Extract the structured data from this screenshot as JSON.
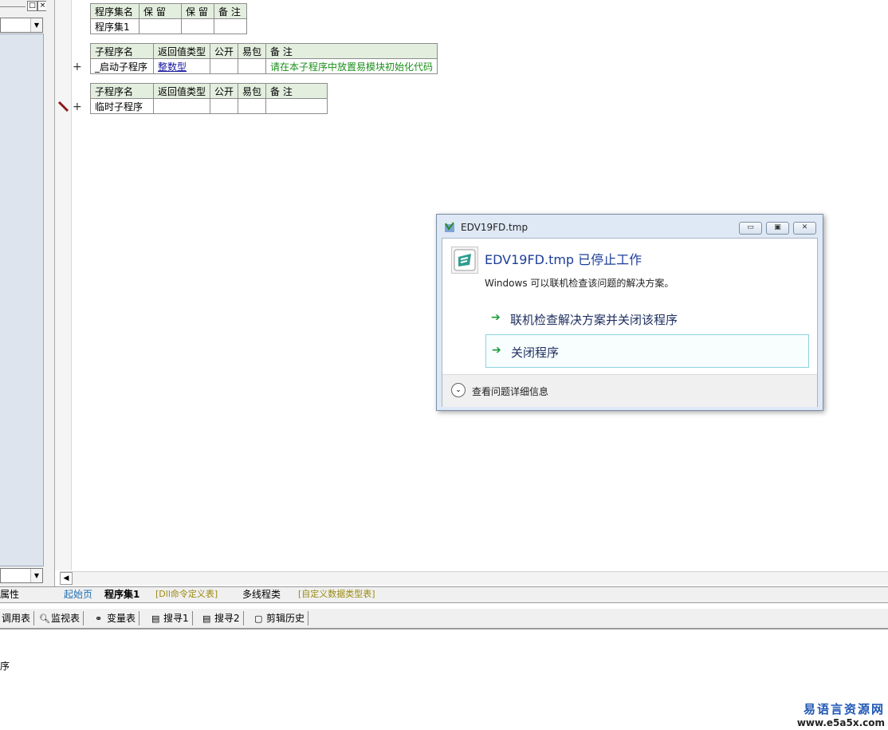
{
  "left_panel": {
    "tiny_buttons": [
      "□",
      "×"
    ],
    "bottom_tab_label": "属性"
  },
  "assembly_table": {
    "headers": [
      "程序集名",
      "保 留",
      "保 留",
      "备 注"
    ],
    "row": [
      "程序集1",
      "",
      "",
      ""
    ]
  },
  "sub1_table": {
    "headers": [
      "子程序名",
      "返回值类型",
      "公开",
      "易包",
      "备 注"
    ],
    "plus": "+",
    "row": [
      "_启动子程序",
      "整数型",
      "",
      "",
      "请在本子程序中放置易模块初始化代码"
    ]
  },
  "sub2_table": {
    "headers": [
      "子程序名",
      "返回值类型",
      "公开",
      "易包",
      "备 注"
    ],
    "plus": "+",
    "row": [
      "临时子程序",
      "",
      "",
      "",
      ""
    ]
  },
  "tabs": [
    "起始页",
    "程序集1",
    "[Dll命令定义表]",
    "多线程类",
    "[自定义数据类型表]"
  ],
  "toolbar": [
    "调用表",
    "监视表",
    "变量表",
    "搜寻1",
    "搜寻2",
    "剪辑历史"
  ],
  "dialog": {
    "title": "EDV19FD.tmp",
    "heading": "EDV19FD.tmp 已停止工作",
    "description": "Windows 可以联机检查该问题的解决方案。",
    "option1": "联机检查解决方案并关闭该程序",
    "option2": "关闭程序",
    "details": "查看问题详细信息",
    "window_buttons": [
      "▭",
      "▣",
      "✕"
    ]
  },
  "status_text": "序",
  "watermark": {
    "line1": "易语言资源网",
    "line2": "www.e5a5x.com"
  },
  "colors": {
    "accent_green": "#1b8f1b",
    "dialog_heading": "#1e3f9a",
    "watermark_blue": "#1f57b5"
  }
}
